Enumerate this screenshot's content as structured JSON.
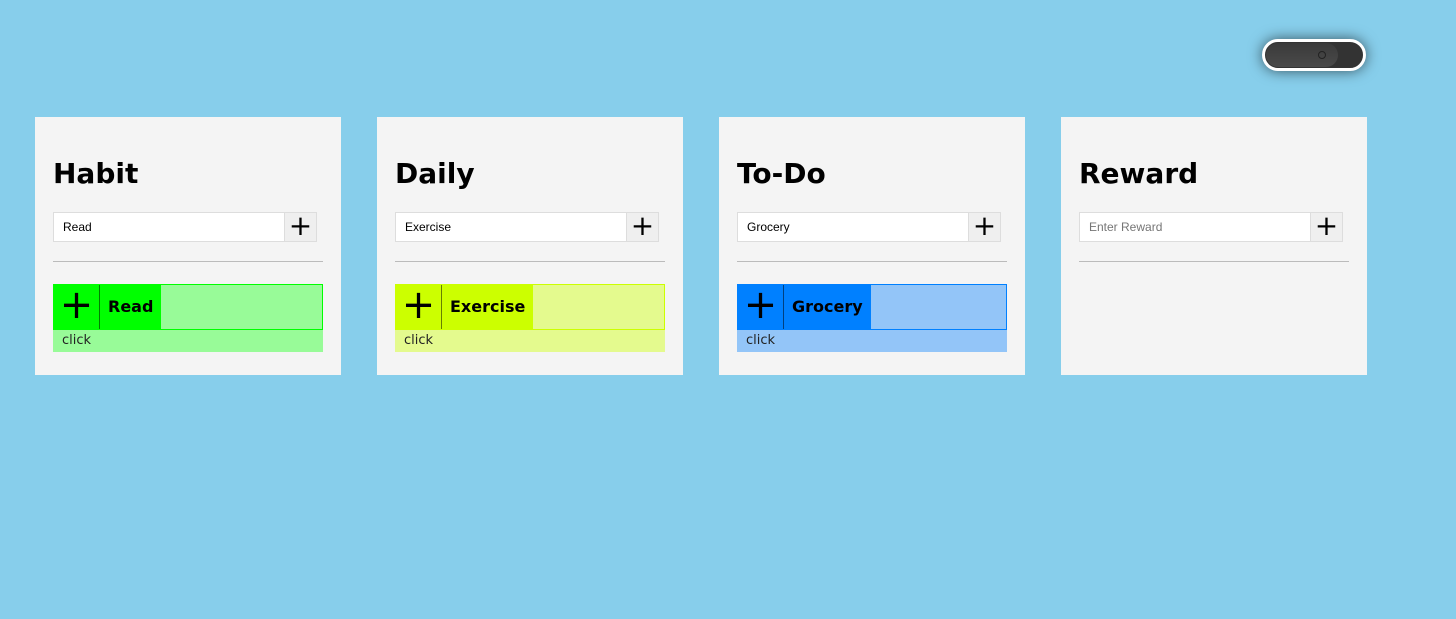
{
  "theme_toggle": {
    "state": "off"
  },
  "columns": [
    {
      "title": "Habit",
      "input_value": "Read",
      "input_placeholder": "",
      "add": "+",
      "item": {
        "label": "Read",
        "plus": "+",
        "footer": "click",
        "color": "#00ff00",
        "light": "#98fb98"
      }
    },
    {
      "title": "Daily",
      "input_value": "Exercise",
      "input_placeholder": "",
      "add": "+",
      "item": {
        "label": "Exercise",
        "plus": "+",
        "footer": "click",
        "color": "#ccff00",
        "light": "#e4fa8e"
      }
    },
    {
      "title": "To-Do",
      "input_value": "Grocery",
      "input_placeholder": "",
      "add": "+",
      "item": {
        "label": "Grocery",
        "plus": "+",
        "footer": "click",
        "color": "#0080ff",
        "light": "#93c5f8"
      }
    },
    {
      "title": "Reward",
      "input_value": "",
      "input_placeholder": "Enter Reward",
      "add": "+"
    }
  ]
}
